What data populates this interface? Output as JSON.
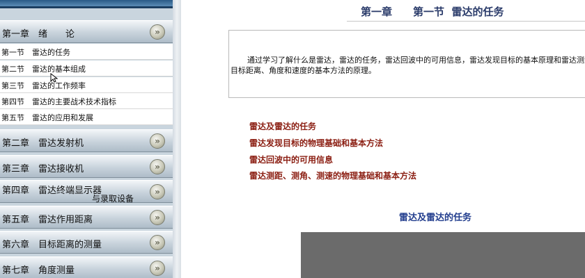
{
  "sidebar": {
    "chapter1": {
      "label": "第一章　绪　　论",
      "chevron": "»"
    },
    "sections": [
      {
        "label": "第一节　雷达的任务"
      },
      {
        "label": "第二节　雷达的基本组成"
      },
      {
        "label": "第三节　雷达的工作频率"
      },
      {
        "label": "第四节　雷达的主要战术技术指标"
      },
      {
        "label": "第五节　雷达的应用和发展"
      }
    ],
    "chapters": [
      {
        "label": "第二章　雷达发射机",
        "label2": ""
      },
      {
        "label": "第三章　雷达接收机",
        "label2": ""
      },
      {
        "label": "第四章　雷达终端显示器",
        "label2": "与录取设备"
      },
      {
        "label": "第五章　雷达作用距离",
        "label2": ""
      },
      {
        "label": "第六章　目标距离的测量",
        "label2": ""
      },
      {
        "label": "第七章　角度测量",
        "label2": ""
      }
    ]
  },
  "main": {
    "title": "第一章　　第一节  雷达的任务",
    "intro": "通过学习了解什么是雷达，雷达的任务，雷达回波中的可用信息，雷达发现目标的基本原理和雷达测量目标距离、角度和速度的基本方法的原理。",
    "topics": [
      "雷达及雷达的任务",
      "雷达发现目标的物理基础和基本方法",
      "雷达回波中的可用信息",
      "雷达测距、测角、测速的物理基础和基本方法"
    ],
    "section_heading": "雷达及雷达的任务"
  },
  "colors": {
    "topic_link": "#8b1e12",
    "heading_blue": "#233e8e",
    "sidebar_bg": "#c9d5de"
  }
}
